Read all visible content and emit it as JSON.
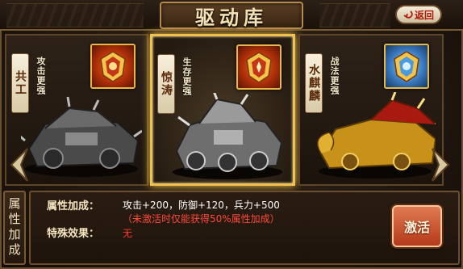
{
  "header": {
    "title": "驱动库",
    "back_label": "返回"
  },
  "cards": [
    {
      "name": "共工",
      "bonus": "攻击更强",
      "emblem_icon": "crest-icon",
      "emblem_color": "#c0401a",
      "selected": false
    },
    {
      "name": "惊涛",
      "bonus": "生存更强",
      "emblem_icon": "crest-icon",
      "emblem_color": "#c0401a",
      "selected": true
    },
    {
      "name": "水麒麟",
      "bonus": "战法更强",
      "emblem_icon": "crest-icon",
      "emblem_color": "#3a7ac0",
      "selected": false
    }
  ],
  "attributes": {
    "tab_label": "属性加成",
    "bonus_label": "属性加成：",
    "bonus_value": "攻击+200，防御+120，兵力+500",
    "bonus_note": "（未激活时仅能获得50%属性加成）",
    "special_label": "特殊效果：",
    "special_value": "无"
  },
  "activate_label": "激活",
  "colors": {
    "selected_border": "#f0c050",
    "note_red": "#ff4a3a",
    "activate_bg": "#c4502a"
  }
}
